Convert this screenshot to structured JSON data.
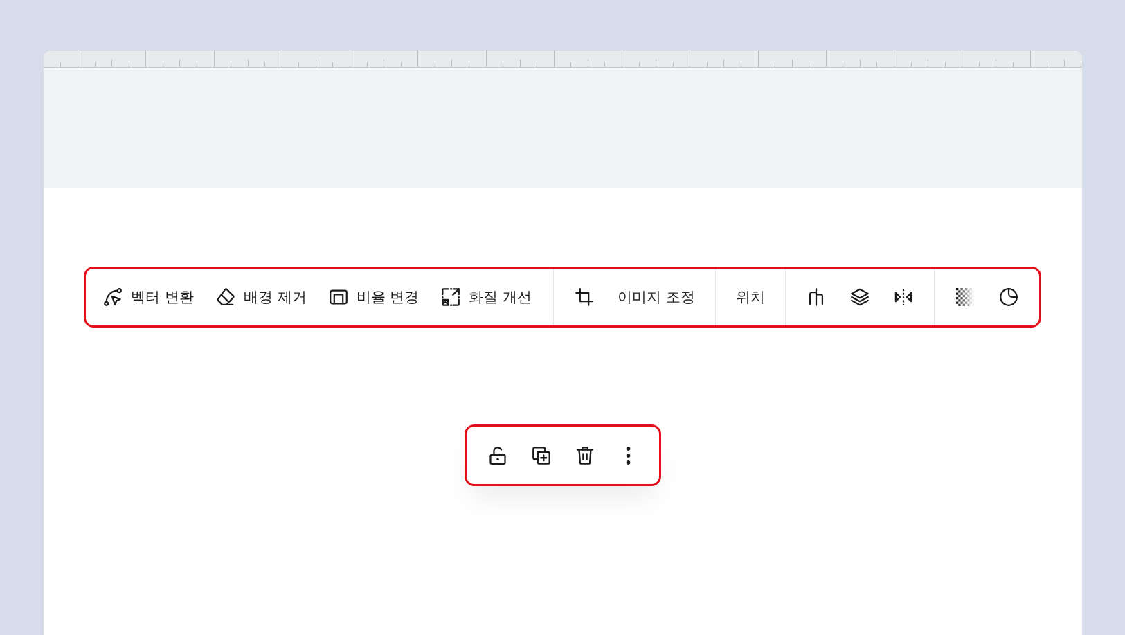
{
  "image_toolbar": {
    "groups": [
      {
        "items": [
          {
            "kind": "icon_label",
            "label": "벡터 변환"
          },
          {
            "kind": "icon_label",
            "label": "배경 제거"
          },
          {
            "kind": "icon_label",
            "label": "비율 변경"
          },
          {
            "kind": "icon_label",
            "label": "화질 개선"
          }
        ]
      },
      {
        "items": [
          {
            "kind": "icon"
          },
          {
            "kind": "text",
            "label": "이미지 조정"
          }
        ]
      },
      {
        "items": [
          {
            "kind": "text",
            "label": "위치"
          }
        ]
      },
      {
        "items": [
          {
            "kind": "icon"
          },
          {
            "kind": "icon"
          },
          {
            "kind": "icon"
          }
        ]
      },
      {
        "items": [
          {
            "kind": "icon"
          },
          {
            "kind": "icon"
          }
        ]
      }
    ]
  },
  "object_toolbar": {
    "items": [
      {
        "kind": "icon"
      },
      {
        "kind": "icon"
      },
      {
        "kind": "icon"
      },
      {
        "kind": "icon"
      }
    ]
  }
}
